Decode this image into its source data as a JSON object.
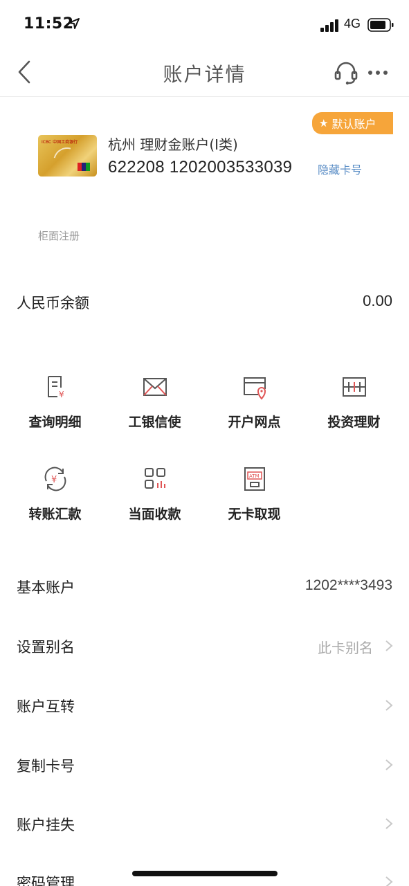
{
  "status_bar": {
    "time": "11:52",
    "network": "4G"
  },
  "nav": {
    "title": "账户详情"
  },
  "card": {
    "badge": "默认账户",
    "account_name": "杭州 理财金账户(Ⅰ类)",
    "account_number": "622208 1202003533039",
    "hide_card_label": "隐藏卡号",
    "registration": "柜面注册",
    "card_logo_text": "ICBC 中国工商银行"
  },
  "balance": {
    "label": "人民币余额",
    "value": "0.00"
  },
  "functions": [
    {
      "label": "查询明细",
      "icon": "transaction-detail-icon"
    },
    {
      "label": "工银信使",
      "icon": "envelope-icon"
    },
    {
      "label": "开户网点",
      "icon": "branch-location-icon"
    },
    {
      "label": "投资理财",
      "icon": "abacus-icon"
    },
    {
      "label": "转账汇款",
      "icon": "transfer-yuan-icon"
    },
    {
      "label": "当面收款",
      "icon": "qr-grid-icon"
    },
    {
      "label": "无卡取现",
      "icon": "atm-icon"
    }
  ],
  "list": [
    {
      "label": "基本账户",
      "value": "1202****3493"
    },
    {
      "label": "设置别名",
      "hint": "此卡别名"
    },
    {
      "label": "账户互转"
    },
    {
      "label": "复制卡号"
    },
    {
      "label": "账户挂失"
    },
    {
      "label": "密码管理"
    }
  ],
  "colors": {
    "badge": "#f6a53a",
    "link": "#5b8ec6",
    "icon_accent": "#e05555"
  }
}
